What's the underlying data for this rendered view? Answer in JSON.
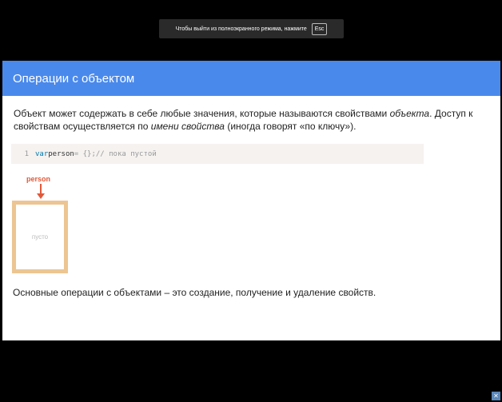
{
  "fullscreen_notice": {
    "text": "Чтобы выйти из полноэкранного режима, нажмите",
    "key": "Esc"
  },
  "slide": {
    "title": "Операции с объектом",
    "intro": {
      "part1": "Объект может содержать в себе любые значения, которые называются свойствами ",
      "em1": "объекта",
      "part2": ". Доступ к свойствам осуществляется по ",
      "em2": "имени свойства",
      "part3": " (иногда говорят «по ключу»)."
    },
    "code": {
      "line_number": "1",
      "keyword": "var",
      "variable": " person",
      "punct": " = {};",
      "comment": " // пока пустой"
    },
    "diagram": {
      "label": "person",
      "box_text": "пусто"
    },
    "summary": "Основные операции с объектами – это создание, получение и удаление свойств."
  },
  "colors": {
    "header": "#4a89ec",
    "box_border": "#ecc592",
    "label": "#e05a3a"
  },
  "icons": {
    "corner": "fullscreen-toggle-icon"
  }
}
